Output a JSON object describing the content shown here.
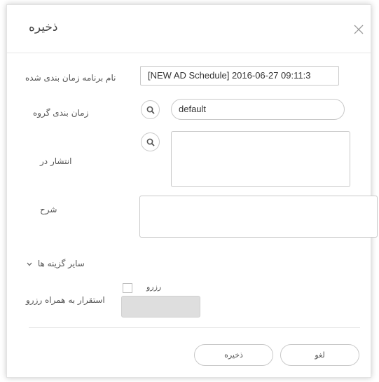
{
  "dialog": {
    "title": "ذخیره",
    "close_icon": "close-icon"
  },
  "form": {
    "schedule_name": {
      "label": "نام برنامه زمان بندی شده",
      "value": "[NEW AD Schedule] 2016-06-27 09:11:3"
    },
    "schedule_group": {
      "label": "زمان بندی گروه",
      "value": "default",
      "icon": "search-icon"
    },
    "publish_in": {
      "label": "انتشار در",
      "icon": "search-icon"
    },
    "description": {
      "label": "شرح"
    },
    "more_options": {
      "label": "سایر گزینه ها",
      "icon": "chevron-down-icon"
    },
    "deploy_with_reservation": {
      "label": "استقرار به همراه رزرو",
      "checkbox_label": "رزرو",
      "checked": false
    }
  },
  "footer": {
    "save_label": "ذخیره",
    "cancel_label": "لغو"
  }
}
